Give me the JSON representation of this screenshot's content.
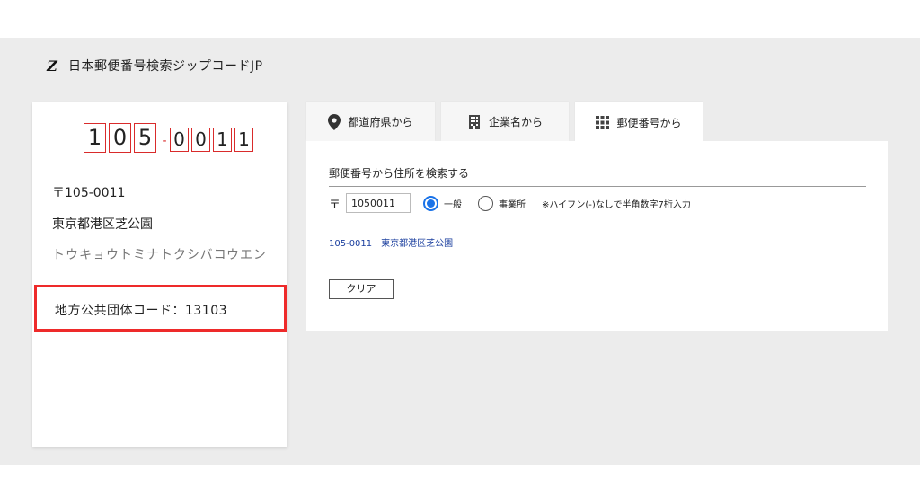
{
  "brand": {
    "logo_glyph": "Z",
    "title": "日本郵便番号検索ジップコードJP"
  },
  "result_card": {
    "digits_first": [
      "1",
      "0",
      "5"
    ],
    "digit_separator": "-",
    "digits_second": [
      "0",
      "0",
      "1",
      "1"
    ],
    "zip_line": "〒105-0011",
    "address": "東京都港区芝公園",
    "kana": "トウキョウトミナトクシバコウエン",
    "local_gov_code": "地方公共団体コード：13103"
  },
  "tabs": [
    {
      "label": "都道府県から",
      "icon": "map-pin-icon"
    },
    {
      "label": "企業名から",
      "icon": "building-icon"
    },
    {
      "label": "郵便番号から",
      "icon": "grid-icon",
      "active": true
    }
  ],
  "search_panel": {
    "heading": "郵便番号から住所を検索する",
    "postal_mark": "〒",
    "zip_value": "1050011",
    "radio_general": "一般",
    "radio_business": "事業所",
    "hint": "※ハイフン(-)なしで半角数字7桁入力",
    "result_link": "105-0011　東京都港区芝公園",
    "clear_label": "クリア"
  },
  "colors": {
    "accent_red": "#d92b2b",
    "highlight_red": "#ee2a2a",
    "link_blue": "#1a3e9e",
    "radio_blue": "#1a73e8",
    "background_gray": "#ececec"
  }
}
